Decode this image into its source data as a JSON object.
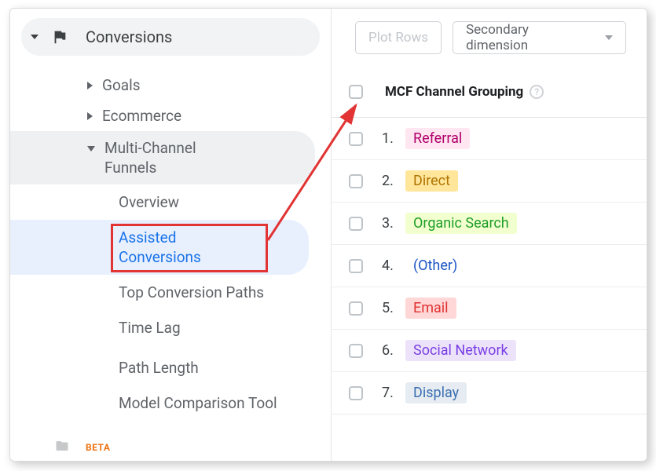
{
  "sidebar": {
    "section_label": "Conversions",
    "children": [
      {
        "label": "Goals",
        "expanded": false
      },
      {
        "label": "Ecommerce",
        "expanded": false
      },
      {
        "label": "Multi-Channel Funnels",
        "expanded": true,
        "children": [
          {
            "label": "Overview"
          },
          {
            "label": "Assisted Conversions",
            "active": true
          },
          {
            "label": "Top Conversion Paths"
          },
          {
            "label": "Time Lag"
          },
          {
            "label": "Path Length"
          },
          {
            "label": "Model Comparison Tool"
          }
        ]
      }
    ],
    "beta_badge": "BETA"
  },
  "toolbar": {
    "plot_rows": "Plot Rows",
    "secondary_dimension": "Secondary dimension"
  },
  "table": {
    "header": "MCF Channel Grouping",
    "rows": [
      {
        "n": "1.",
        "label": "Referral",
        "fg": "#b0006b",
        "bg": "#ffe6f0"
      },
      {
        "n": "2.",
        "label": "Direct",
        "fg": "#b07400",
        "bg": "#ffe69a"
      },
      {
        "n": "3.",
        "label": "Organic Search",
        "fg": "#1e9e28",
        "bg": "#f2ffcf"
      },
      {
        "n": "4.",
        "label": "(Other)",
        "fg": "#1b55c4",
        "bg": "transparent"
      },
      {
        "n": "5.",
        "label": "Email",
        "fg": "#e03131",
        "bg": "#ffd7d7"
      },
      {
        "n": "6.",
        "label": "Social Network",
        "fg": "#7b3fe4",
        "bg": "#ece3fb"
      },
      {
        "n": "7.",
        "label": "Display",
        "fg": "#3a6fb0",
        "bg": "#e7ecf2"
      }
    ]
  },
  "colors": {
    "link": "#1a73e8",
    "red": "#e23434"
  }
}
